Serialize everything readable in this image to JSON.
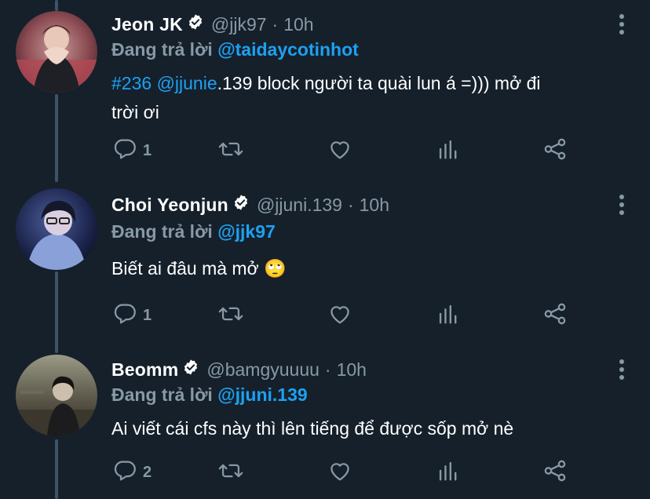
{
  "tweets": [
    {
      "name": "Jeon JK",
      "handle": "@jjk97",
      "separator": "·",
      "time": "10h",
      "reply_prefix": "Đang trả lời",
      "reply_to": "@taidaycotinhot",
      "body": {
        "hashtag": "#236",
        "mention": "@jjunie",
        "text_1": ".139 block người ta quài lun á =))) mở đi",
        "text_2": "trời ơi"
      },
      "reply_count": "1"
    },
    {
      "name": "Choi Yeonjun",
      "handle": "@jjuni.139",
      "separator": "·",
      "time": "10h",
      "reply_prefix": "Đang trả lời",
      "reply_to": "@jjk97",
      "body": {
        "text": "Biết ai đâu mà mở 🙄"
      },
      "reply_count": "1"
    },
    {
      "name": "Beomm",
      "handle": "@bamgyuuuu",
      "separator": "·",
      "time": "10h",
      "reply_prefix": "Đang trả lời",
      "reply_to": "@jjuni.139",
      "body": {
        "text": "Ai viết cái cfs này thì lên tiếng để được sốp mở nè"
      },
      "reply_count": "2"
    }
  ],
  "icons": {
    "reply": "reply-icon",
    "retweet": "retweet-icon",
    "like": "like-icon",
    "analytics": "analytics-icon",
    "share": "share-icon",
    "verified": "verified-badge-icon",
    "more": "more-options-icon"
  },
  "colors": {
    "background": "#15202b",
    "text_secondary": "#8899a6",
    "accent": "#1da1f2",
    "thread_line": "#3d5466"
  }
}
